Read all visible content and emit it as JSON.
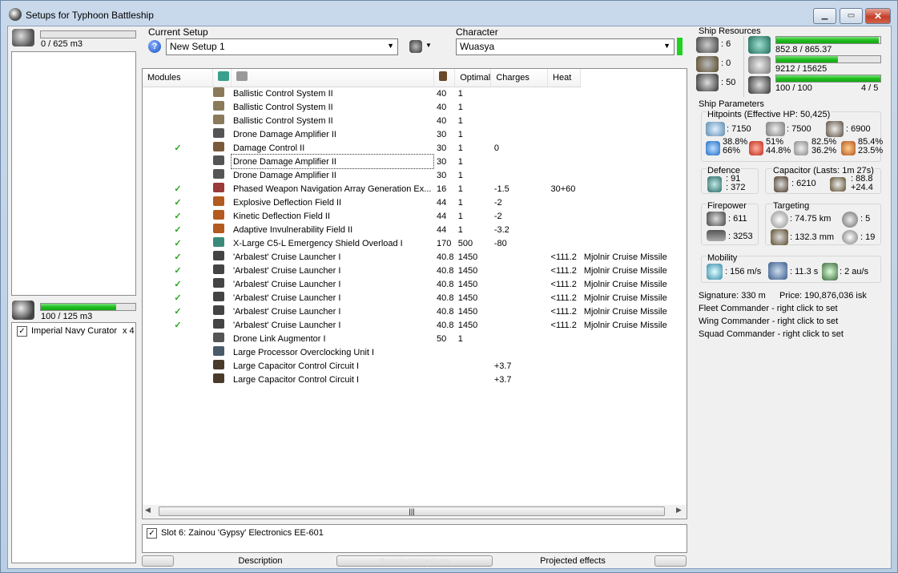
{
  "window": {
    "title": "Setups for Typhoon Battleship"
  },
  "cargo": {
    "value": "0 / 625 m3",
    "fill": 0.0
  },
  "dronebay": {
    "value": "100 / 125 m3",
    "fill": 0.8,
    "item_label": "Imperial Navy Curator",
    "item_count": "x 4"
  },
  "setup": {
    "label": "Current Setup",
    "value": "New Setup 1"
  },
  "character": {
    "label": "Character",
    "value": "Wuasya"
  },
  "modules": {
    "headers": {
      "name": "Modules",
      "optimal": "Optimal",
      "charges": "Charges",
      "heat": "Heat"
    },
    "rows": [
      {
        "check": "",
        "icon": "#8a7a5a",
        "name": "Ballistic Control System II",
        "cpu": "40",
        "pg": "1",
        "cap": "",
        "opt": "",
        "charges": ""
      },
      {
        "check": "",
        "icon": "#8a7a5a",
        "name": "Ballistic Control System II",
        "cpu": "40",
        "pg": "1",
        "cap": "",
        "opt": "",
        "charges": ""
      },
      {
        "check": "",
        "icon": "#8a7a5a",
        "name": "Ballistic Control System II",
        "cpu": "40",
        "pg": "1",
        "cap": "",
        "opt": "",
        "charges": ""
      },
      {
        "check": "",
        "icon": "#555",
        "name": "Drone Damage Amplifier II",
        "cpu": "30",
        "pg": "1",
        "cap": "",
        "opt": "",
        "charges": ""
      },
      {
        "check": "✓",
        "icon": "#7a5a3a",
        "name": "Damage Control II",
        "cpu": "30",
        "pg": "1",
        "cap": "0",
        "opt": "",
        "charges": ""
      },
      {
        "check": "",
        "icon": "#555",
        "name": "Drone Damage Amplifier II",
        "cpu": "30",
        "pg": "1",
        "cap": "",
        "opt": "",
        "charges": ""
      },
      {
        "check": "",
        "icon": "#555",
        "name": "Drone Damage Amplifier II",
        "cpu": "30",
        "pg": "1",
        "cap": "",
        "opt": "",
        "charges": ""
      },
      {
        "check": "✓",
        "icon": "#9a3a3a",
        "name": "Phased Weapon Navigation Array Generation Ex...",
        "cpu": "16",
        "pg": "1",
        "cap": "-1.5",
        "opt": "30+60",
        "charges": ""
      },
      {
        "check": "✓",
        "icon": "#b35a20",
        "name": "Explosive Deflection Field II",
        "cpu": "44",
        "pg": "1",
        "cap": "-2",
        "opt": "",
        "charges": ""
      },
      {
        "check": "✓",
        "icon": "#b35a20",
        "name": "Kinetic Deflection Field II",
        "cpu": "44",
        "pg": "1",
        "cap": "-2",
        "opt": "",
        "charges": ""
      },
      {
        "check": "✓",
        "icon": "#b35a20",
        "name": "Adaptive Invulnerability Field II",
        "cpu": "44",
        "pg": "1",
        "cap": "-3.2",
        "opt": "",
        "charges": ""
      },
      {
        "check": "✓",
        "icon": "#3a8a7a",
        "name": "X-Large C5-L Emergency Shield Overload I",
        "cpu": "170",
        "pg": "500",
        "cap": "-80",
        "opt": "",
        "charges": ""
      },
      {
        "check": "✓",
        "icon": "#444",
        "name": "'Arbalest' Cruise Launcher I",
        "cpu": "40.8",
        "pg": "1450",
        "cap": "",
        "opt": "<111.2",
        "charges": "Mjolnir Cruise Missile"
      },
      {
        "check": "✓",
        "icon": "#444",
        "name": "'Arbalest' Cruise Launcher I",
        "cpu": "40.8",
        "pg": "1450",
        "cap": "",
        "opt": "<111.2",
        "charges": "Mjolnir Cruise Missile"
      },
      {
        "check": "✓",
        "icon": "#444",
        "name": "'Arbalest' Cruise Launcher I",
        "cpu": "40.8",
        "pg": "1450",
        "cap": "",
        "opt": "<111.2",
        "charges": "Mjolnir Cruise Missile"
      },
      {
        "check": "✓",
        "icon": "#444",
        "name": "'Arbalest' Cruise Launcher I",
        "cpu": "40.8",
        "pg": "1450",
        "cap": "",
        "opt": "<111.2",
        "charges": "Mjolnir Cruise Missile"
      },
      {
        "check": "✓",
        "icon": "#444",
        "name": "'Arbalest' Cruise Launcher I",
        "cpu": "40.8",
        "pg": "1450",
        "cap": "",
        "opt": "<111.2",
        "charges": "Mjolnir Cruise Missile"
      },
      {
        "check": "✓",
        "icon": "#444",
        "name": "'Arbalest' Cruise Launcher I",
        "cpu": "40.8",
        "pg": "1450",
        "cap": "",
        "opt": "<111.2",
        "charges": "Mjolnir Cruise Missile"
      },
      {
        "check": "",
        "icon": "#555",
        "name": "Drone Link Augmentor I",
        "cpu": "50",
        "pg": "1",
        "cap": "",
        "opt": "",
        "charges": ""
      },
      {
        "check": "",
        "icon": "#4a5a6a",
        "name": "Large Processor Overclocking Unit I",
        "cpu": "",
        "pg": "",
        "cap": "",
        "opt": "",
        "charges": ""
      },
      {
        "check": "",
        "icon": "#4a3a2a",
        "name": "Large Capacitor Control Circuit I",
        "cpu": "",
        "pg": "",
        "cap": "+3.7",
        "opt": "",
        "charges": ""
      },
      {
        "check": "",
        "icon": "#4a3a2a",
        "name": "Large Capacitor Control Circuit I",
        "cpu": "",
        "pg": "",
        "cap": "+3.7",
        "opt": "",
        "charges": ""
      }
    ]
  },
  "implant": {
    "label": "Slot 6: Zainou 'Gypsy' Electronics EE-601"
  },
  "bottom_tabs": {
    "description": "Description",
    "boosters": "Boosters\\Implants",
    "projected": "Projected effects"
  },
  "resources": {
    "title": "Ship Resources",
    "turret": ": 6",
    "launcher": ": 0",
    "drones": ": 50",
    "cpu": "852.8 / 865.37",
    "cpu_fill": 0.985,
    "power": "9212 / 15625",
    "power_fill": 0.59,
    "drone_bw": "100 / 100",
    "drone_bw_fill": 1.0,
    "drone_count": "4 / 5"
  },
  "params": {
    "title": "Ship Parameters",
    "hp_title": "Hitpoints (Effective HP: 50,425)",
    "shield_hp": ": 7150",
    "armor_hp": ": 7500",
    "hull_hp": ": 6900",
    "shield_res": [
      "38.8%",
      "66%"
    ],
    "em_res": [
      "51%",
      "44.8%"
    ],
    "kin_res": [
      "82.5%",
      "36.2%"
    ],
    "exp_res": [
      "85.4%",
      "23.5%"
    ],
    "defence_title": "Defence",
    "def_a": ": 91",
    "def_b": ": 372",
    "capacitor_title": "Capacitor (Lasts: 1m 27s)",
    "cap_amount": ": 6210",
    "cap_a": ": 88.8",
    "cap_b": "+24.4",
    "firepower_title": "Firepower",
    "fp_a": ": 611",
    "fp_b": ": 3253",
    "targeting_title": "Targeting",
    "range": ": 74.75 km",
    "max_targets": ": 5",
    "scan_res": ": 132.3 mm",
    "sensor": ": 19",
    "mobility_title": "Mobility",
    "speed": ": 156 m/s",
    "align": ": 11.3 s",
    "warp": ": 2 au/s",
    "signature": "Signature: 330 m",
    "price": "Price: 190,876,036 isk",
    "fleet": "Fleet Commander - right click to set",
    "wing": "Wing Commander - right click to set",
    "squad": "Squad Commander - right click to set"
  }
}
